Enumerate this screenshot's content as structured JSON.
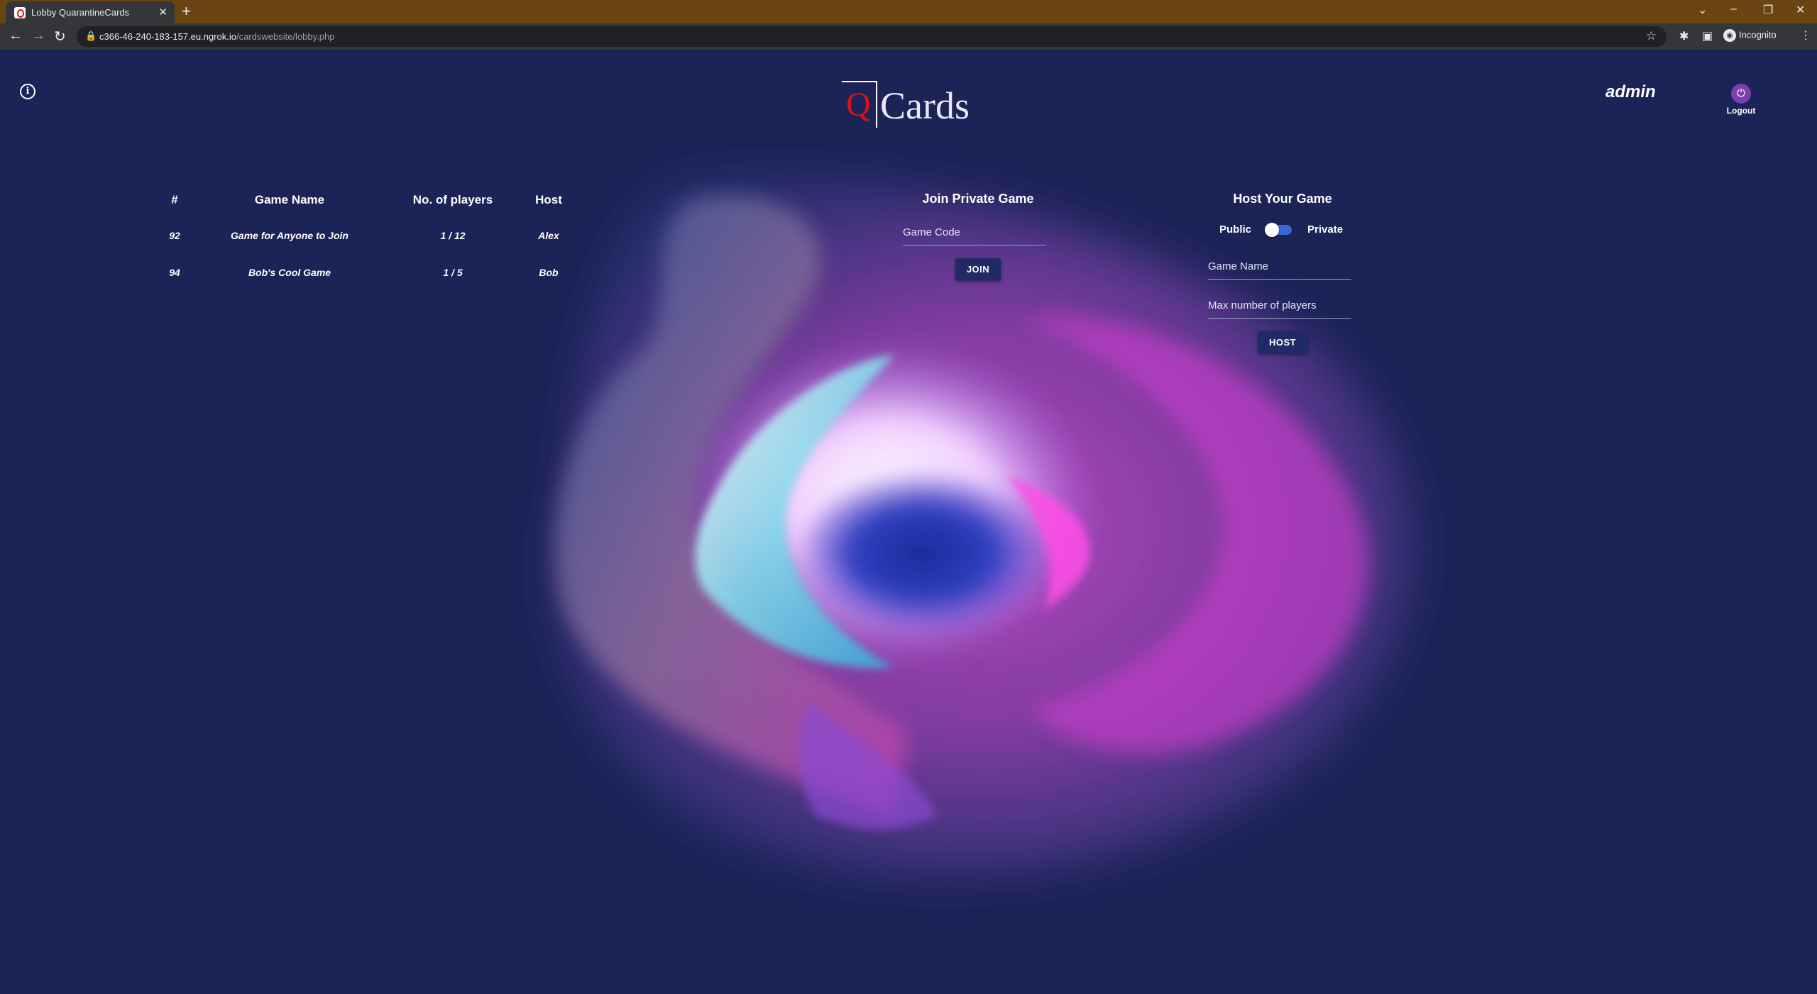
{
  "browser": {
    "tab_title": "Lobby QuarantineCards",
    "url_host": "c366-46-240-183-157.eu.ngrok.io",
    "url_path": "/cardswebsite/lobby.php",
    "incognito_label": "Incognito"
  },
  "header": {
    "logo_letter": "Q",
    "logo_text": "Cards",
    "username": "admin",
    "logout_label": "Logout"
  },
  "games_table": {
    "headers": [
      "#",
      "Game Name",
      "No. of players",
      "Host"
    ],
    "rows": [
      {
        "id": "92",
        "name": "Game for Anyone to Join",
        "players": "1 / 12",
        "host": "Alex"
      },
      {
        "id": "94",
        "name": "Bob's Cool Game",
        "players": "1 / 5",
        "host": "Bob"
      }
    ]
  },
  "join_private": {
    "title": "Join Private Game",
    "code_placeholder": "Game Code",
    "join_label": "JOIN"
  },
  "host_game": {
    "title": "Host Your Game",
    "public_label": "Public",
    "private_label": "Private",
    "private_selected": false,
    "name_placeholder": "Game Name",
    "max_players_placeholder": "Max number of players",
    "host_label": "HOST"
  },
  "colors": {
    "background": "#1b2357",
    "tabbar": "#6a4512",
    "logo_q": "#d2141c",
    "toggle": "#3b68d8"
  }
}
